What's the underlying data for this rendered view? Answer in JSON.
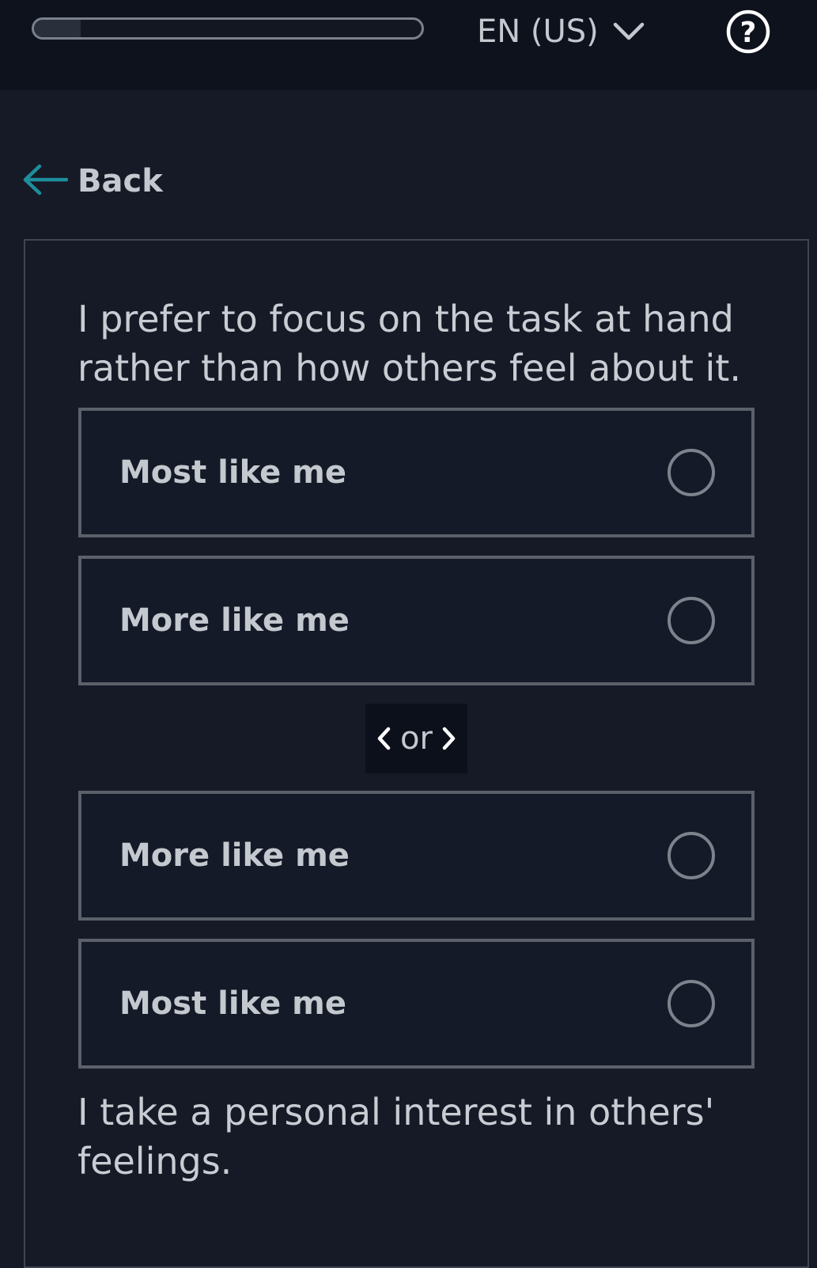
{
  "header": {
    "progress": 0.12,
    "language_label": "EN (US)",
    "help_symbol": "?"
  },
  "nav": {
    "back_label": "Back"
  },
  "questions": [
    {
      "text": "I prefer to focus on the task at hand rather than how others feel about it.",
      "options": [
        {
          "label": "Most like me"
        },
        {
          "label": "More like me"
        }
      ]
    },
    {
      "text": "I take a personal interest in others' feelings.",
      "options": [
        {
          "label": "More like me"
        },
        {
          "label": "Most like me"
        }
      ]
    }
  ],
  "separator": {
    "label": "or"
  },
  "icons": {
    "back": "arrow-left-icon",
    "language": "chevron-down-icon",
    "help": "question-circle-icon",
    "separator_left": "chevron-left-icon",
    "separator_right": "chevron-right-icon"
  },
  "colors": {
    "accent": "#1f8d9c",
    "background": "#151a26",
    "header_bg": "#0e121d",
    "text": "#c4c8cf",
    "option_border": "#5b606a"
  }
}
